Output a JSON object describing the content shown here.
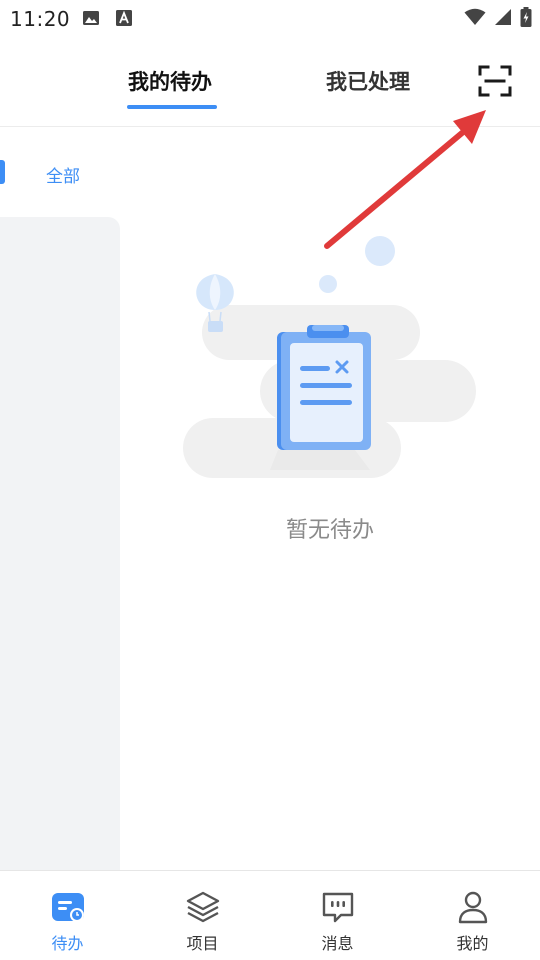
{
  "status_bar": {
    "time": "11:20"
  },
  "header": {
    "tabs": [
      {
        "label": "我的待办",
        "active": true
      },
      {
        "label": "我已处理",
        "active": false
      }
    ],
    "scan_icon": "scan-icon"
  },
  "category": {
    "label": "全部"
  },
  "empty_state": {
    "message": "暂无待办"
  },
  "bottom_nav": {
    "items": [
      {
        "label": "待办",
        "icon": "todo-icon",
        "active": true
      },
      {
        "label": "项目",
        "icon": "layers-icon",
        "active": false
      },
      {
        "label": "消息",
        "icon": "message-icon",
        "active": false
      },
      {
        "label": "我的",
        "icon": "profile-icon",
        "active": false
      }
    ]
  },
  "colors": {
    "accent": "#3d8ef5",
    "arrow": "#e03a3a"
  }
}
